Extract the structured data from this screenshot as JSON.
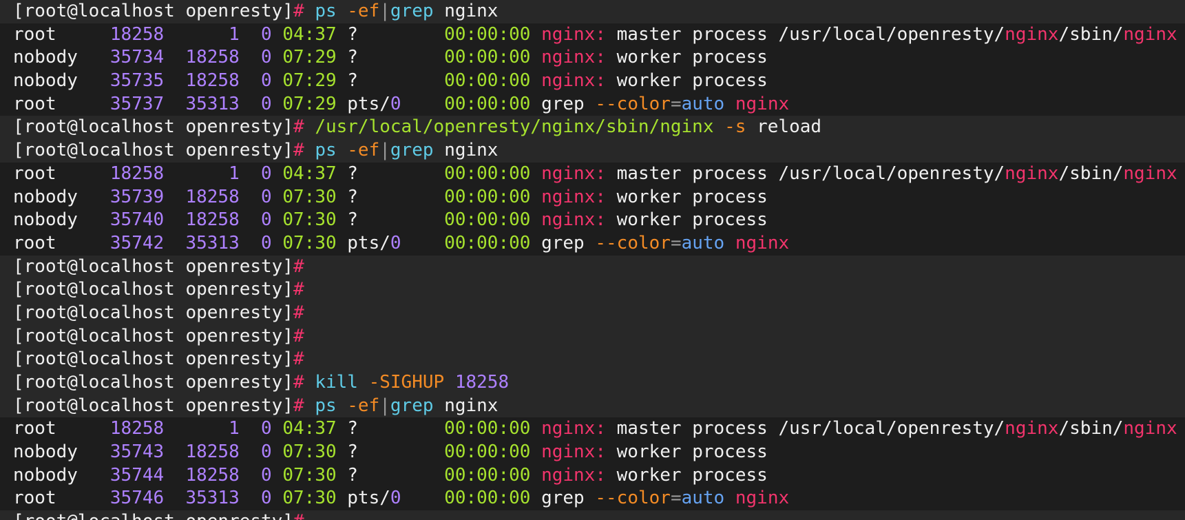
{
  "colors": {
    "background": "#1d1d1d",
    "prompt_line_bg": "#282828",
    "text": "#f0f0f0",
    "hash": "#f2346c",
    "command": "#5fcbe6",
    "option": "#f38b25",
    "pid": "#ae81ff",
    "time": "#a6e22e",
    "highlight": "#f2346c",
    "arg_value": "#66a3f2"
  },
  "lines": [
    {
      "kind": "cmd",
      "tokens": [
        {
          "t": "[root@localhost openresty]",
          "c": "white"
        },
        {
          "t": "# ",
          "c": "pink"
        },
        {
          "t": "ps ",
          "c": "cyan"
        },
        {
          "t": "-ef",
          "c": "orange"
        },
        {
          "t": "|",
          "c": "gray"
        },
        {
          "t": "grep ",
          "c": "cyan"
        },
        {
          "t": "nginx",
          "c": "white"
        }
      ]
    },
    {
      "kind": "out",
      "tokens": [
        {
          "t": "root     ",
          "c": "white"
        },
        {
          "t": "18258      ",
          "c": "purple"
        },
        {
          "t": "1  ",
          "c": "purple"
        },
        {
          "t": "0 ",
          "c": "purple"
        },
        {
          "t": "04:37 ",
          "c": "lime"
        },
        {
          "t": "?        ",
          "c": "white"
        },
        {
          "t": "00:00:00 ",
          "c": "lime"
        },
        {
          "t": "nginx: ",
          "c": "pink"
        },
        {
          "t": "master process /usr/local/openresty/",
          "c": "white"
        },
        {
          "t": "nginx",
          "c": "pink"
        },
        {
          "t": "/sbin/",
          "c": "white"
        },
        {
          "t": "nginx",
          "c": "pink"
        }
      ]
    },
    {
      "kind": "out",
      "tokens": [
        {
          "t": "nobody   ",
          "c": "white"
        },
        {
          "t": "35734  ",
          "c": "purple"
        },
        {
          "t": "18258  ",
          "c": "purple"
        },
        {
          "t": "0 ",
          "c": "purple"
        },
        {
          "t": "07:29 ",
          "c": "lime"
        },
        {
          "t": "?        ",
          "c": "white"
        },
        {
          "t": "00:00:00 ",
          "c": "lime"
        },
        {
          "t": "nginx: ",
          "c": "pink"
        },
        {
          "t": "worker process",
          "c": "white"
        }
      ]
    },
    {
      "kind": "out",
      "tokens": [
        {
          "t": "nobody   ",
          "c": "white"
        },
        {
          "t": "35735  ",
          "c": "purple"
        },
        {
          "t": "18258  ",
          "c": "purple"
        },
        {
          "t": "0 ",
          "c": "purple"
        },
        {
          "t": "07:29 ",
          "c": "lime"
        },
        {
          "t": "?        ",
          "c": "white"
        },
        {
          "t": "00:00:00 ",
          "c": "lime"
        },
        {
          "t": "nginx: ",
          "c": "pink"
        },
        {
          "t": "worker process",
          "c": "white"
        }
      ]
    },
    {
      "kind": "out",
      "tokens": [
        {
          "t": "root     ",
          "c": "white"
        },
        {
          "t": "35737  ",
          "c": "purple"
        },
        {
          "t": "35313  ",
          "c": "purple"
        },
        {
          "t": "0 ",
          "c": "purple"
        },
        {
          "t": "07:29 ",
          "c": "lime"
        },
        {
          "t": "pts/",
          "c": "white"
        },
        {
          "t": "0    ",
          "c": "purple"
        },
        {
          "t": "00:00:00 ",
          "c": "lime"
        },
        {
          "t": "grep ",
          "c": "white"
        },
        {
          "t": "--color",
          "c": "orange"
        },
        {
          "t": "=",
          "c": "gray"
        },
        {
          "t": "auto ",
          "c": "blue"
        },
        {
          "t": "nginx",
          "c": "pink"
        }
      ]
    },
    {
      "kind": "cmd",
      "tokens": [
        {
          "t": "[root@localhost openresty]",
          "c": "white"
        },
        {
          "t": "# ",
          "c": "pink"
        },
        {
          "t": "/usr/local/openresty/nginx/sbin/nginx ",
          "c": "lime"
        },
        {
          "t": "-s ",
          "c": "orange"
        },
        {
          "t": "reload",
          "c": "white"
        }
      ]
    },
    {
      "kind": "cmd",
      "tokens": [
        {
          "t": "[root@localhost openresty]",
          "c": "white"
        },
        {
          "t": "# ",
          "c": "pink"
        },
        {
          "t": "ps ",
          "c": "cyan"
        },
        {
          "t": "-ef",
          "c": "orange"
        },
        {
          "t": "|",
          "c": "gray"
        },
        {
          "t": "grep ",
          "c": "cyan"
        },
        {
          "t": "nginx",
          "c": "white"
        }
      ]
    },
    {
      "kind": "out",
      "tokens": [
        {
          "t": "root     ",
          "c": "white"
        },
        {
          "t": "18258      ",
          "c": "purple"
        },
        {
          "t": "1  ",
          "c": "purple"
        },
        {
          "t": "0 ",
          "c": "purple"
        },
        {
          "t": "04:37 ",
          "c": "lime"
        },
        {
          "t": "?        ",
          "c": "white"
        },
        {
          "t": "00:00:00 ",
          "c": "lime"
        },
        {
          "t": "nginx: ",
          "c": "pink"
        },
        {
          "t": "master process /usr/local/openresty/",
          "c": "white"
        },
        {
          "t": "nginx",
          "c": "pink"
        },
        {
          "t": "/sbin/",
          "c": "white"
        },
        {
          "t": "nginx",
          "c": "pink"
        }
      ]
    },
    {
      "kind": "out",
      "tokens": [
        {
          "t": "nobody   ",
          "c": "white"
        },
        {
          "t": "35739  ",
          "c": "purple"
        },
        {
          "t": "18258  ",
          "c": "purple"
        },
        {
          "t": "0 ",
          "c": "purple"
        },
        {
          "t": "07:30 ",
          "c": "lime"
        },
        {
          "t": "?        ",
          "c": "white"
        },
        {
          "t": "00:00:00 ",
          "c": "lime"
        },
        {
          "t": "nginx: ",
          "c": "pink"
        },
        {
          "t": "worker process",
          "c": "white"
        }
      ]
    },
    {
      "kind": "out",
      "tokens": [
        {
          "t": "nobody   ",
          "c": "white"
        },
        {
          "t": "35740  ",
          "c": "purple"
        },
        {
          "t": "18258  ",
          "c": "purple"
        },
        {
          "t": "0 ",
          "c": "purple"
        },
        {
          "t": "07:30 ",
          "c": "lime"
        },
        {
          "t": "?        ",
          "c": "white"
        },
        {
          "t": "00:00:00 ",
          "c": "lime"
        },
        {
          "t": "nginx: ",
          "c": "pink"
        },
        {
          "t": "worker process",
          "c": "white"
        }
      ]
    },
    {
      "kind": "out",
      "tokens": [
        {
          "t": "root     ",
          "c": "white"
        },
        {
          "t": "35742  ",
          "c": "purple"
        },
        {
          "t": "35313  ",
          "c": "purple"
        },
        {
          "t": "0 ",
          "c": "purple"
        },
        {
          "t": "07:30 ",
          "c": "lime"
        },
        {
          "t": "pts/",
          "c": "white"
        },
        {
          "t": "0    ",
          "c": "purple"
        },
        {
          "t": "00:00:00 ",
          "c": "lime"
        },
        {
          "t": "grep ",
          "c": "white"
        },
        {
          "t": "--color",
          "c": "orange"
        },
        {
          "t": "=",
          "c": "gray"
        },
        {
          "t": "auto ",
          "c": "blue"
        },
        {
          "t": "nginx",
          "c": "pink"
        }
      ]
    },
    {
      "kind": "cmd",
      "tokens": [
        {
          "t": "[root@localhost openresty]",
          "c": "white"
        },
        {
          "t": "#",
          "c": "pink"
        }
      ]
    },
    {
      "kind": "cmd",
      "tokens": [
        {
          "t": "[root@localhost openresty]",
          "c": "white"
        },
        {
          "t": "#",
          "c": "pink"
        }
      ]
    },
    {
      "kind": "cmd",
      "tokens": [
        {
          "t": "[root@localhost openresty]",
          "c": "white"
        },
        {
          "t": "#",
          "c": "pink"
        }
      ]
    },
    {
      "kind": "cmd",
      "tokens": [
        {
          "t": "[root@localhost openresty]",
          "c": "white"
        },
        {
          "t": "#",
          "c": "pink"
        }
      ]
    },
    {
      "kind": "cmd",
      "tokens": [
        {
          "t": "[root@localhost openresty]",
          "c": "white"
        },
        {
          "t": "#",
          "c": "pink"
        }
      ]
    },
    {
      "kind": "cmd",
      "tokens": [
        {
          "t": "[root@localhost openresty]",
          "c": "white"
        },
        {
          "t": "# ",
          "c": "pink"
        },
        {
          "t": "kill ",
          "c": "cyan"
        },
        {
          "t": "-SIGHUP ",
          "c": "orange"
        },
        {
          "t": "18258",
          "c": "purple"
        }
      ]
    },
    {
      "kind": "cmd",
      "tokens": [
        {
          "t": "[root@localhost openresty]",
          "c": "white"
        },
        {
          "t": "# ",
          "c": "pink"
        },
        {
          "t": "ps ",
          "c": "cyan"
        },
        {
          "t": "-ef",
          "c": "orange"
        },
        {
          "t": "|",
          "c": "gray"
        },
        {
          "t": "grep ",
          "c": "cyan"
        },
        {
          "t": "nginx",
          "c": "white"
        }
      ]
    },
    {
      "kind": "out",
      "tokens": [
        {
          "t": "root     ",
          "c": "white"
        },
        {
          "t": "18258      ",
          "c": "purple"
        },
        {
          "t": "1  ",
          "c": "purple"
        },
        {
          "t": "0 ",
          "c": "purple"
        },
        {
          "t": "04:37 ",
          "c": "lime"
        },
        {
          "t": "?        ",
          "c": "white"
        },
        {
          "t": "00:00:00 ",
          "c": "lime"
        },
        {
          "t": "nginx: ",
          "c": "pink"
        },
        {
          "t": "master process /usr/local/openresty/",
          "c": "white"
        },
        {
          "t": "nginx",
          "c": "pink"
        },
        {
          "t": "/sbin/",
          "c": "white"
        },
        {
          "t": "nginx",
          "c": "pink"
        }
      ]
    },
    {
      "kind": "out",
      "tokens": [
        {
          "t": "nobody   ",
          "c": "white"
        },
        {
          "t": "35743  ",
          "c": "purple"
        },
        {
          "t": "18258  ",
          "c": "purple"
        },
        {
          "t": "0 ",
          "c": "purple"
        },
        {
          "t": "07:30 ",
          "c": "lime"
        },
        {
          "t": "?        ",
          "c": "white"
        },
        {
          "t": "00:00:00 ",
          "c": "lime"
        },
        {
          "t": "nginx: ",
          "c": "pink"
        },
        {
          "t": "worker process",
          "c": "white"
        }
      ]
    },
    {
      "kind": "out",
      "tokens": [
        {
          "t": "nobody   ",
          "c": "white"
        },
        {
          "t": "35744  ",
          "c": "purple"
        },
        {
          "t": "18258  ",
          "c": "purple"
        },
        {
          "t": "0 ",
          "c": "purple"
        },
        {
          "t": "07:30 ",
          "c": "lime"
        },
        {
          "t": "?        ",
          "c": "white"
        },
        {
          "t": "00:00:00 ",
          "c": "lime"
        },
        {
          "t": "nginx: ",
          "c": "pink"
        },
        {
          "t": "worker process",
          "c": "white"
        }
      ]
    },
    {
      "kind": "out",
      "tokens": [
        {
          "t": "root     ",
          "c": "white"
        },
        {
          "t": "35746  ",
          "c": "purple"
        },
        {
          "t": "35313  ",
          "c": "purple"
        },
        {
          "t": "0 ",
          "c": "purple"
        },
        {
          "t": "07:30 ",
          "c": "lime"
        },
        {
          "t": "pts/",
          "c": "white"
        },
        {
          "t": "0    ",
          "c": "purple"
        },
        {
          "t": "00:00:00 ",
          "c": "lime"
        },
        {
          "t": "grep ",
          "c": "white"
        },
        {
          "t": "--color",
          "c": "orange"
        },
        {
          "t": "=",
          "c": "gray"
        },
        {
          "t": "auto ",
          "c": "blue"
        },
        {
          "t": "nginx",
          "c": "pink"
        }
      ]
    },
    {
      "kind": "cmd",
      "partial": true,
      "tokens": [
        {
          "t": "[root@localhost openresty]",
          "c": "white"
        },
        {
          "t": "#",
          "c": "pink"
        }
      ]
    }
  ]
}
